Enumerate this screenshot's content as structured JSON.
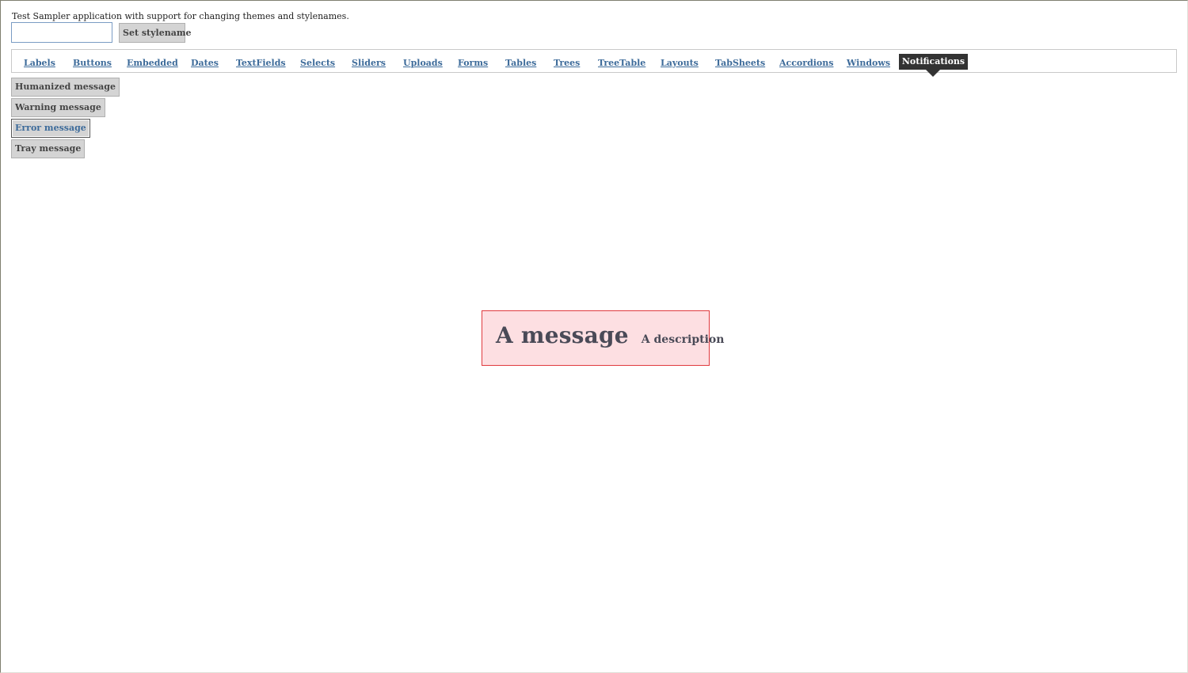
{
  "header": {
    "description": "Test Sampler application with support for changing themes and stylenames.",
    "stylename_input_value": "",
    "set_stylename_label": "Set stylename"
  },
  "tabs": [
    {
      "label": "Labels",
      "selected": false
    },
    {
      "label": "Buttons",
      "selected": false
    },
    {
      "label": "Embedded",
      "selected": false
    },
    {
      "label": "Dates",
      "selected": false
    },
    {
      "label": "TextFields",
      "selected": false
    },
    {
      "label": "Selects",
      "selected": false
    },
    {
      "label": "Sliders",
      "selected": false
    },
    {
      "label": "Uploads",
      "selected": false
    },
    {
      "label": "Forms",
      "selected": false
    },
    {
      "label": "Tables",
      "selected": false
    },
    {
      "label": "Trees",
      "selected": false
    },
    {
      "label": "TreeTable",
      "selected": false
    },
    {
      "label": "Layouts",
      "selected": false
    },
    {
      "label": "TabSheets",
      "selected": false
    },
    {
      "label": "Accordions",
      "selected": false
    },
    {
      "label": "Windows",
      "selected": false
    },
    {
      "label": "Notifications",
      "selected": true
    }
  ],
  "message_buttons": [
    {
      "label": "Humanized message"
    },
    {
      "label": "Warning message"
    },
    {
      "label": "Error message",
      "focused": true
    },
    {
      "label": "Tray message"
    }
  ],
  "notification": {
    "caption": "A message",
    "description": "A description",
    "type": "error",
    "background_color": "#fddfe2",
    "border_color": "#e03a3e"
  },
  "colors": {
    "link": "#3d6b9a",
    "selected_tab_bg": "#333333",
    "button_bg": "#d4d4d4"
  }
}
